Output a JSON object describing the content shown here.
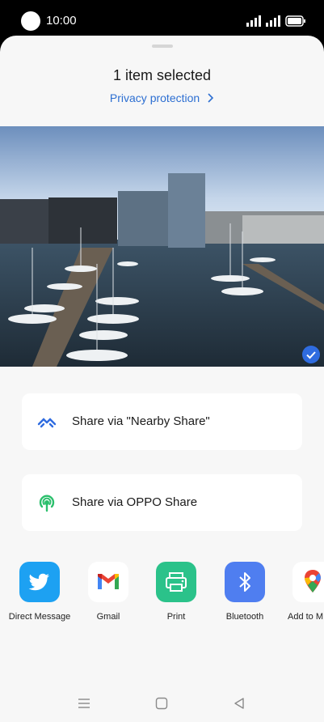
{
  "status": {
    "time": "10:00"
  },
  "sheet": {
    "title": "1 item selected",
    "privacy_link": "Privacy protection"
  },
  "share_options": [
    {
      "label": "Share via \"Nearby Share\"",
      "icon": "nearby-share-icon"
    },
    {
      "label": "Share via OPPO Share",
      "icon": "oppo-share-icon"
    }
  ],
  "apps": [
    {
      "label": "Direct Message",
      "icon": "twitter-icon",
      "color": "#1da1f2"
    },
    {
      "label": "Gmail",
      "icon": "gmail-icon",
      "color": "#ffffff"
    },
    {
      "label": "Print",
      "icon": "print-icon",
      "color": "#2bc28a"
    },
    {
      "label": "Bluetooth",
      "icon": "bluetooth-icon",
      "color": "#4f7ef0"
    },
    {
      "label": "Add to M",
      "icon": "google-maps-icon",
      "color": "#ffffff"
    }
  ],
  "nav": [
    "menu-icon",
    "home-icon",
    "back-icon"
  ]
}
